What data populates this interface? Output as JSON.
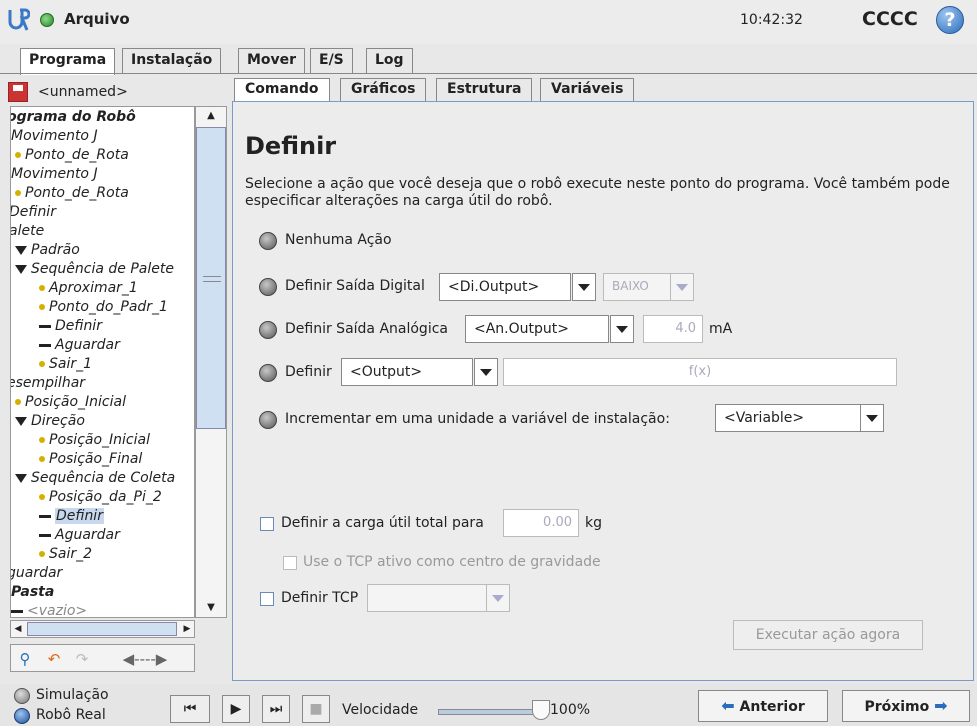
{
  "header": {
    "file_label": "Arquivo",
    "clock": "10:42:32",
    "robot_name": "CCCC",
    "help_glyph": "?"
  },
  "main_tabs": [
    "Programa",
    "Instalação",
    "Mover",
    "E/S",
    "Log"
  ],
  "left": {
    "filename": "<unnamed>",
    "tree": [
      "ograma do Robô",
      "Movimento J",
      "Ponto_de_Rota",
      "Movimento J",
      "Ponto_de_Rota",
      "Definir",
      "alete",
      "Padrão",
      "Sequência de Palete",
      "Aproximar_1",
      "Ponto_do_Padr_1",
      "Definir",
      "Aguardar",
      "Sair_1",
      "esempilhar",
      "Posição_Inicial",
      "Direção",
      "Posição_Inicial",
      "Posição_Final",
      "Sequência de Coleta",
      "Posição_da_Pi_2",
      "Definir",
      "Aguardar",
      "Sair_2",
      "guardar",
      "Pasta",
      "<vazio>"
    ]
  },
  "sub_tabs": [
    "Comando",
    "Gráficos",
    "Estrutura",
    "Variáveis"
  ],
  "content": {
    "title": "Definir",
    "description": "Selecione a ação que você deseja que o robô execute neste ponto do programa. Você também pode especificar alterações na carga útil do robô.",
    "opt_none": "Nenhuma Ação",
    "opt_digital": "Definir Saída Digital",
    "digital_output": "<Di.Output>",
    "digital_value": "BAIXO",
    "opt_analog": "Definir Saída Analógica",
    "analog_output": "<An.Output>",
    "analog_value": "4.0",
    "analog_unit": "mA",
    "opt_set": "Definir",
    "set_output": "<Output>",
    "set_expression": "f(x)",
    "opt_increment": "Incrementar em uma unidade a variável de instalação:",
    "increment_variable": "<Variable>",
    "payload_label": "Definir a carga útil total para",
    "payload_value": "0.00",
    "payload_unit": "kg",
    "tcp_cog_label": "Use o TCP ativo como centro de gravidade",
    "tcp_label": "Definir TCP",
    "run_now": "Executar ação agora"
  },
  "bottom": {
    "mode_sim": "Simulação",
    "mode_real": "Robô Real",
    "speed_label": "Velocidade",
    "speed_value": "100%",
    "speed_fraction": 1.0,
    "prev": "Anterior",
    "next": "Próximo"
  }
}
